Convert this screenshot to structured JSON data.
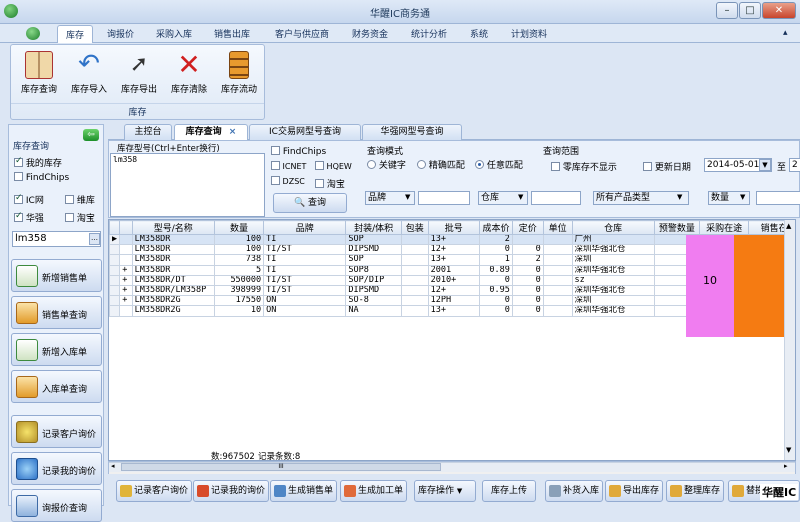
{
  "window": {
    "title": "华醒IC商务通"
  },
  "menu": [
    "库存",
    "询报价",
    "采购入库",
    "销售出库",
    "客户与供应商",
    "财务资金",
    "统计分析",
    "系统",
    "计划资料"
  ],
  "ribbon": {
    "buttons": [
      {
        "label": "库存查询",
        "icon": "book-icon",
        "color": "#b23a3a"
      },
      {
        "label": "库存导入",
        "icon": "undo-arrow-icon",
        "color": "#2f73c8"
      },
      {
        "label": "库存导出",
        "icon": "cursor-icon",
        "color": "#555"
      },
      {
        "label": "库存清除",
        "icon": "red-x-icon",
        "color": "#d02020"
      },
      {
        "label": "库存流动",
        "icon": "cabinet-icon",
        "color": "#e07f1a"
      }
    ],
    "group_label": "库存"
  },
  "left": {
    "title": "库存查询",
    "checks": [
      {
        "label": "我的库存",
        "checked": true
      },
      {
        "label": "FindChips",
        "checked": false
      },
      {
        "label": "IC网",
        "checked": true
      },
      {
        "label": "维库",
        "checked": false
      },
      {
        "label": "华强",
        "checked": true
      },
      {
        "label": "淘宝",
        "checked": false
      }
    ],
    "search_value": "lm358",
    "nav": [
      {
        "label": "新增销售单",
        "icon": "new-sales-icon"
      },
      {
        "label": "销售单查询",
        "icon": "sales-query-icon"
      },
      {
        "label": "新增入库单",
        "icon": "new-inbound-icon"
      },
      {
        "label": "入库单查询",
        "icon": "inbound-query-icon"
      },
      {
        "label": "记录客户询价",
        "icon": "customer-inquiry-icon"
      },
      {
        "label": "记录我的询价",
        "icon": "my-inquiry-icon"
      },
      {
        "label": "询报价查询",
        "icon": "inquiry-query-icon"
      }
    ]
  },
  "tabs": [
    {
      "label": "主控台"
    },
    {
      "label": "库存查询",
      "close": "×"
    },
    {
      "label": "IC交易网型号查询"
    },
    {
      "label": "华强网型号查询"
    }
  ],
  "query": {
    "model_label": "库存型号(Ctrl+Enter换行)",
    "model_value": "lm358",
    "sources": [
      {
        "label": "FindChips"
      },
      {
        "label": "ICNET"
      },
      {
        "label": "HQEW"
      },
      {
        "label": "DZSC"
      },
      {
        "label": "淘宝"
      }
    ],
    "query_button": "查询",
    "mode_label": "查询模式",
    "modes": [
      {
        "label": "关键字",
        "selected": false
      },
      {
        "label": "精确匹配",
        "selected": false
      },
      {
        "label": "任意匹配",
        "selected": true
      }
    ],
    "range_label": "查询范围",
    "zero_stock": "零库存不显示",
    "update_date": "更新日期",
    "date_from": "2014-05-01",
    "to": "至",
    "to_value": "2",
    "brand": "品牌",
    "warehouse": "仓库",
    "product_type": "所有产品类型",
    "quantity": "数量"
  },
  "grid": {
    "columns": [
      "型号/名称",
      "数量",
      "品牌",
      "封装/体积",
      "包装",
      "批号",
      "成本价",
      "定价",
      "单位",
      "仓库",
      "预警数量",
      "采购在途",
      "销售在途"
    ],
    "rows": [
      {
        "expand": "",
        "model": "LM358DR",
        "qty": "100",
        "brand": "TI",
        "pkg": "SOP",
        "packing": "",
        "batch": "13+",
        "cost": "2",
        "price": "",
        "unit": "",
        "wh": "广州",
        "alert": "",
        "selected": true
      },
      {
        "expand": "",
        "model": "LM358DR",
        "qty": "100",
        "brand": "TI/ST",
        "pkg": "DIPSMD",
        "packing": "",
        "batch": "12+",
        "cost": "0",
        "price": "0",
        "unit": "",
        "wh": "深圳华强北仓",
        "alert": "0"
      },
      {
        "expand": "",
        "model": "LM358DR",
        "qty": "738",
        "brand": "TI",
        "pkg": "SOP",
        "packing": "",
        "batch": "13+",
        "cost": "1",
        "price": "2",
        "unit": "",
        "wh": "深圳",
        "alert": "0"
      },
      {
        "expand": "+",
        "model": "LM358DR",
        "qty": "5",
        "brand": "TI",
        "pkg": "SOP8",
        "packing": "",
        "batch": "2001",
        "cost": "0.89",
        "price": "0",
        "unit": "",
        "wh": "深圳华强北仓",
        "alert": "0"
      },
      {
        "expand": "+",
        "model": "LM358DR/DT",
        "qty": "550000",
        "brand": "TI/ST",
        "pkg": "SOP/DIP",
        "packing": "",
        "batch": "2010+",
        "cost": "0",
        "price": "0",
        "unit": "",
        "wh": "sz",
        "alert": "0"
      },
      {
        "expand": "+",
        "model": "LM358DR/LM358P",
        "qty": "398999",
        "brand": "TI/ST",
        "pkg": "DIPSMD",
        "packing": "",
        "batch": "12+",
        "cost": "0.95",
        "price": "0",
        "unit": "",
        "wh": "深圳华强北仓",
        "alert": "0"
      },
      {
        "expand": "+",
        "model": "LM358DR2G",
        "qty": "17550",
        "brand": "ON",
        "pkg": "SO-8",
        "packing": "",
        "batch": "12PH",
        "cost": "0",
        "price": "0",
        "unit": "",
        "wh": "深圳",
        "alert": "0"
      },
      {
        "expand": "",
        "model": "LM358DR2G",
        "qty": "10",
        "brand": "ON",
        "pkg": "NA",
        "packing": "",
        "batch": "13+",
        "cost": "0",
        "price": "0",
        "unit": "",
        "wh": "深圳华强北仓",
        "alert": "0"
      }
    ],
    "purchase_transit_value": "10",
    "summary_qty": "数:967502",
    "summary_count": "记录条数:8",
    "hscroll_mark": "III"
  },
  "bottom_buttons": [
    "记录客户询价",
    "记录我的询价",
    "生成销售单",
    "生成加工单",
    "库存操作",
    "库存上传",
    "补货入库",
    "导出库存",
    "整理库存",
    "替换入库"
  ],
  "watermark": "华醒IC"
}
